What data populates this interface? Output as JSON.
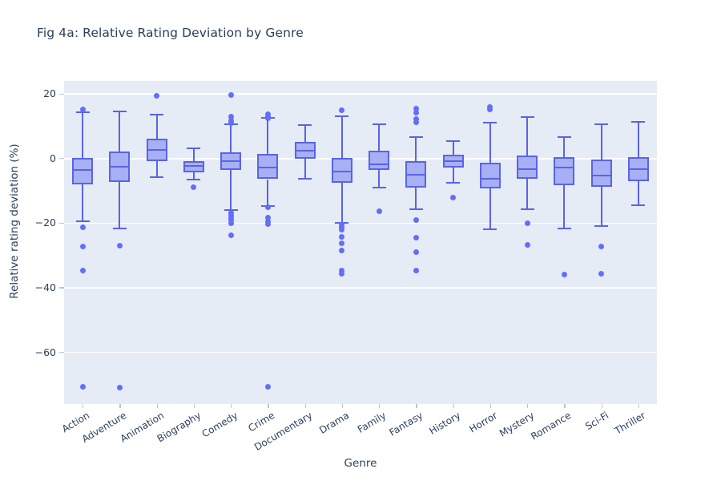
{
  "chart": {
    "title": "Fig 4a: Relative Rating Deviation by Genre",
    "xlabel": "Genre",
    "ylabel": "Relative rating deviation (%)",
    "colors": {
      "plot_background": "#e5ecf6",
      "gridline": "#ffffff",
      "box_fill": "#a7b0f4",
      "box_line": "#5a63e8",
      "marker": "#636efa",
      "text": "#2a3f5f",
      "paper_background": "#ffffff"
    }
  },
  "chart_data": {
    "type": "box",
    "title": "Fig 4a: Relative Rating Deviation by Genre",
    "xlabel": "Genre",
    "ylabel": "Relative rating deviation (%)",
    "ylim": [
      -76,
      24
    ],
    "yticks": [
      20,
      0,
      -20,
      -40,
      -60
    ],
    "ytick_labels": [
      "20",
      "0",
      "−20",
      "−40",
      "−60"
    ],
    "grid": true,
    "legend": false,
    "orientation": "vertical",
    "categories": [
      "Action",
      "Adventure",
      "Animation",
      "Biography",
      "Comedy",
      "Crime",
      "Documentary",
      "Drama",
      "Family",
      "Fantasy",
      "History",
      "Horror",
      "Mystery",
      "Romance",
      "Sci-Fi",
      "Thriller"
    ],
    "boxes": [
      {
        "category": "Action",
        "whisker_low": -19.5,
        "q1": -8.0,
        "median": -3.5,
        "q3": 0.2,
        "whisker_high": 14.3,
        "outliers": [
          15.2,
          -21.2,
          -27.3,
          -34.6,
          -70.6
        ]
      },
      {
        "category": "Adventure",
        "whisker_low": -21.6,
        "q1": -7.2,
        "median": -2.6,
        "q3": 2.2,
        "whisker_high": 14.6,
        "outliers": [
          -27.0,
          -70.8
        ]
      },
      {
        "category": "Animation",
        "whisker_low": -5.8,
        "q1": -0.8,
        "median": 2.6,
        "q3": 6.1,
        "whisker_high": 13.6,
        "outliers": [
          19.5
        ]
      },
      {
        "category": "Biography",
        "whisker_low": -6.6,
        "q1": -4.4,
        "median": -2.4,
        "q3": -0.9,
        "whisker_high": 3.2,
        "outliers": [
          -8.9
        ]
      },
      {
        "category": "Comedy",
        "whisker_low": -16.0,
        "q1": -3.6,
        "median": -0.9,
        "q3": 1.9,
        "whisker_high": 10.6,
        "outliers": [
          19.6,
          13.0,
          11.6,
          10.9,
          -16.8,
          -17.6,
          -18.3,
          -19.1,
          -20.0,
          -23.8
        ]
      },
      {
        "category": "Crime",
        "whisker_low": -14.8,
        "q1": -6.4,
        "median": -2.8,
        "q3": 1.4,
        "whisker_high": 12.6,
        "outliers": [
          13.8,
          13.0,
          12.4,
          -15.2,
          -18.4,
          -19.6,
          -20.2,
          -70.7
        ]
      },
      {
        "category": "Documentary",
        "whisker_low": -6.2,
        "q1": 0.0,
        "median": 2.3,
        "q3": 5.1,
        "whisker_high": 10.4,
        "outliers": []
      },
      {
        "category": "Drama",
        "whisker_low": -19.8,
        "q1": -7.4,
        "median": -4.0,
        "q3": 0.1,
        "whisker_high": 13.2,
        "outliers": [
          15.0,
          -20.6,
          -21.2,
          -22.0,
          -24.2,
          -26.3,
          -28.4,
          -34.8,
          -35.6
        ]
      },
      {
        "category": "Family",
        "whisker_low": -8.9,
        "q1": -3.6,
        "median": -1.9,
        "q3": 2.5,
        "whisker_high": 10.6,
        "outliers": [
          -16.2
        ]
      },
      {
        "category": "Fantasy",
        "whisker_low": -15.8,
        "q1": -9.0,
        "median": -5.1,
        "q3": -0.8,
        "whisker_high": 6.6,
        "outliers": [
          15.4,
          14.3,
          12.1,
          11.3,
          -19.0,
          -24.6,
          -28.9,
          -34.7
        ]
      },
      {
        "category": "History",
        "whisker_low": -7.4,
        "q1": -2.8,
        "median": -0.8,
        "q3": 1.1,
        "whisker_high": 5.4,
        "outliers": [
          -12.1
        ]
      },
      {
        "category": "Horror",
        "whisker_low": -21.8,
        "q1": -9.3,
        "median": -6.2,
        "q3": -1.3,
        "whisker_high": 11.0,
        "outliers": [
          16.0,
          15.2
        ]
      },
      {
        "category": "Mystery",
        "whisker_low": -15.8,
        "q1": -6.3,
        "median": -3.4,
        "q3": 0.9,
        "whisker_high": 12.8,
        "outliers": [
          -20.0,
          -26.8
        ]
      },
      {
        "category": "Romance",
        "whisker_low": -21.6,
        "q1": -8.3,
        "median": -2.9,
        "q3": 0.4,
        "whisker_high": 6.6,
        "outliers": [
          -35.9
        ]
      },
      {
        "category": "Sci-Fi",
        "whisker_low": -20.8,
        "q1": -8.7,
        "median": -5.4,
        "q3": -0.4,
        "whisker_high": 10.6,
        "outliers": [
          -27.2,
          -35.7
        ]
      },
      {
        "category": "Thriller",
        "whisker_low": -14.4,
        "q1": -7.0,
        "median": -3.3,
        "q3": 0.5,
        "whisker_high": 11.4,
        "outliers": []
      }
    ]
  }
}
